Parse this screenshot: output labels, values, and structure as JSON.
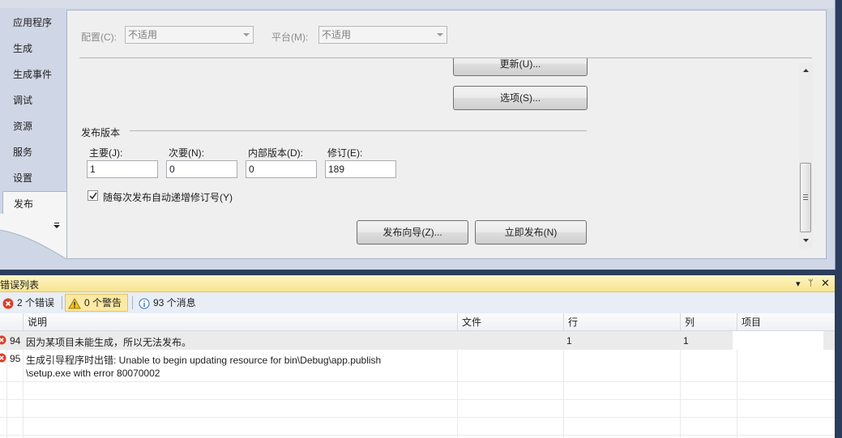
{
  "sidebar": {
    "tabs": [
      {
        "label": "应用程序"
      },
      {
        "label": "生成"
      },
      {
        "label": "生成事件"
      },
      {
        "label": "调试"
      },
      {
        "label": "资源"
      },
      {
        "label": "服务"
      },
      {
        "label": "设置"
      },
      {
        "label": "发布",
        "active": true
      }
    ]
  },
  "config": {
    "config_label": "配置(C):",
    "config_value": "不适用",
    "platform_label": "平台(M):",
    "platform_value": "不适用"
  },
  "publish": {
    "update_button": "更新(U)...",
    "options_button": "选项(S)...",
    "version_section": "发布版本",
    "major_label": "主要(J):",
    "minor_label": "次要(N):",
    "build_label": "内部版本(D):",
    "revision_label": "修订(E):",
    "major_value": "1",
    "minor_value": "0",
    "build_value": "0",
    "revision_value": "189",
    "auto_increment_label": "随每次发布自动递增修订号(Y)",
    "auto_increment_checked": true,
    "wizard_button": "发布向导(Z)...",
    "publish_now_button": "立即发布(N)"
  },
  "error_list": {
    "title": "错误列表",
    "errors_filter": "2 个错误",
    "warnings_filter": "0 个警告",
    "messages_filter": "93 个消息",
    "columns": {
      "description": "说明",
      "file": "文件",
      "line": "行",
      "column": "列",
      "project": "项目"
    },
    "rows": [
      {
        "num": "94",
        "description": "因为某项目未能生成，所以无法发布。",
        "file": "",
        "line": "1",
        "column": "1",
        "project": ""
      },
      {
        "num": "95",
        "description": "生成引导程序时出错: Unable to begin updating resource for bin\\Debug\\app.publish",
        "description2": "\\setup.exe with error 80070002",
        "file": "",
        "line": "",
        "column": "",
        "project": ""
      }
    ]
  },
  "colors": {
    "error_icon": "#d9402a",
    "warning_icon": "#f2c21b",
    "info_icon": "#2d6fc4",
    "title_bar": "#f8e48f"
  }
}
